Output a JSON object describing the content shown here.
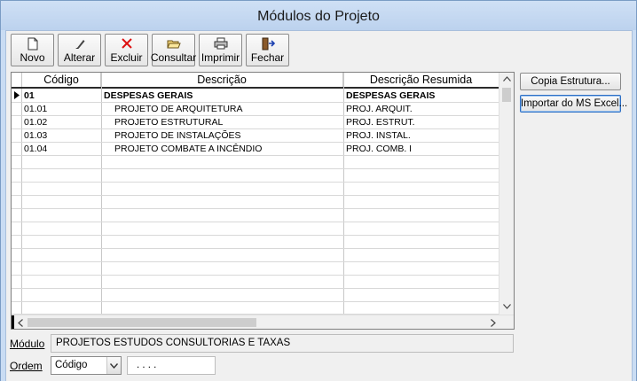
{
  "window": {
    "title": "Módulos do Projeto"
  },
  "toolbar": {
    "buttons": [
      {
        "label": "Novo",
        "icon": "new-document-icon"
      },
      {
        "label": "Alterar",
        "icon": "pencil-icon"
      },
      {
        "label": "Excluir",
        "icon": "delete-x-icon"
      },
      {
        "label": "Consultar",
        "icon": "open-folder-icon"
      },
      {
        "label": "Imprimir",
        "icon": "printer-icon"
      },
      {
        "label": "Fechar",
        "icon": "exit-door-icon"
      }
    ]
  },
  "grid": {
    "columns": [
      "Código",
      "Descrição",
      "Descrição Resumida"
    ],
    "rows": [
      {
        "codigo": "01",
        "descricao": "DESPESAS GERAIS",
        "resumida": "DESPESAS GERAIS"
      },
      {
        "codigo": "01.01",
        "descricao": "PROJETO DE ARQUITETURA",
        "resumida": "PROJ. ARQUIT."
      },
      {
        "codigo": "01.02",
        "descricao": "PROJETO ESTRUTURAL",
        "resumida": "PROJ. ESTRUT."
      },
      {
        "codigo": "01.03",
        "descricao": "PROJETO DE INSTALAÇÕES",
        "resumida": "PROJ. INSTAL."
      },
      {
        "codigo": "01.04",
        "descricao": "PROJETO COMBATE A INCÊNDIO",
        "resumida": "PROJ. COMB. I"
      }
    ]
  },
  "side_buttons": {
    "copia": "Copia Estrutura...",
    "importar": "Importar do MS Excel..."
  },
  "modulo": {
    "label": "Módulo",
    "value": "PROJETOS ESTUDOS CONSULTORIAS E TAXAS"
  },
  "ordem": {
    "label": "Ordem",
    "selected": "Código",
    "mask": ". . . ."
  }
}
